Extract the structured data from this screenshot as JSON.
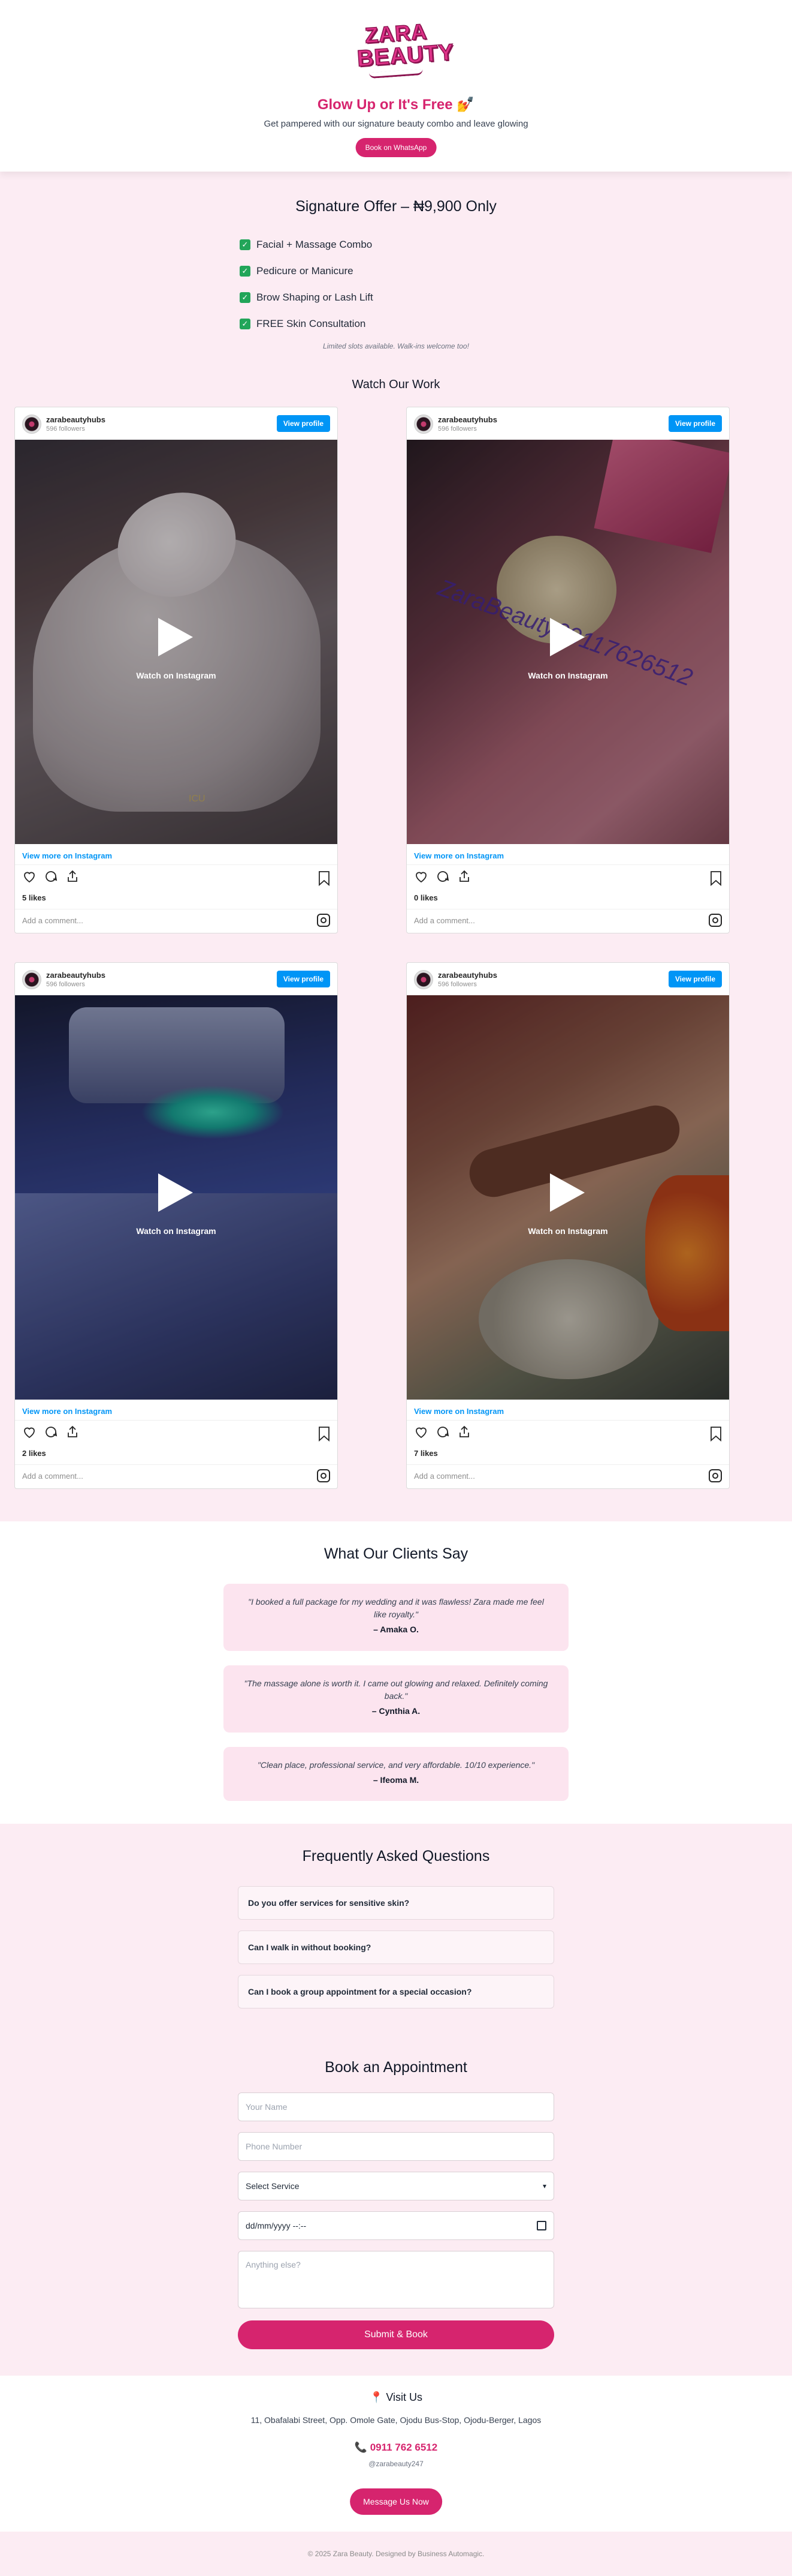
{
  "brand": {
    "logo_line1": "ZARA",
    "logo_line2": "BEAUTY",
    "accent": "#d6246e"
  },
  "hero": {
    "title": "Glow Up or It's Free 💅",
    "subtitle": "Get pampered with our signature beauty combo and leave glowing",
    "cta": "Book on WhatsApp"
  },
  "offer": {
    "title": "Signature Offer – ₦9,900 Only",
    "items": [
      "Facial + Massage Combo",
      "Pedicure or Manicure",
      "Brow Shaping or Lash Lift",
      "FREE Skin Consultation"
    ],
    "note": "Limited slots available. Walk-ins welcome too!"
  },
  "work": {
    "title": "Watch Our Work",
    "posts": [
      {
        "user": "zarabeautyhubs",
        "followers": "596 followers",
        "view": "View profile",
        "watch": "Watch on Instagram",
        "more": "View more on Instagram",
        "likes": "5 likes",
        "comment": "Add a comment...",
        "overlay": "ICU"
      },
      {
        "user": "zarabeautyhubs",
        "followers": "596 followers",
        "view": "View profile",
        "watch": "Watch on Instagram",
        "more": "View more on Instagram",
        "likes": "0 likes",
        "comment": "Add a comment...",
        "overlay": "ZaraBeauty09117626512"
      },
      {
        "user": "zarabeautyhubs",
        "followers": "596 followers",
        "view": "View profile",
        "watch": "Watch on Instagram",
        "more": "View more on Instagram",
        "likes": "2 likes",
        "comment": "Add a comment...",
        "overlay": ""
      },
      {
        "user": "zarabeautyhubs",
        "followers": "596 followers",
        "view": "View profile",
        "watch": "Watch on Instagram",
        "more": "View more on Instagram",
        "likes": "7 likes",
        "comment": "Add a comment...",
        "overlay": ""
      }
    ]
  },
  "testimonials": {
    "title": "What Our Clients Say",
    "items": [
      {
        "quote": "\"I booked a full package for my wedding and it was flawless! Zara made me feel like royalty.\"",
        "author": "– Amaka O."
      },
      {
        "quote": "\"The massage alone is worth it. I came out glowing and relaxed. Definitely coming back.\"",
        "author": "– Cynthia A."
      },
      {
        "quote": "\"Clean place, professional service, and very affordable. 10/10 experience.\"",
        "author": "– Ifeoma M."
      }
    ]
  },
  "faq": {
    "title": "Frequently Asked Questions",
    "items": [
      "Do you offer services for sensitive skin?",
      "Can I walk in without booking?",
      "Can I book a group appointment for a special occasion?"
    ]
  },
  "booking": {
    "title": "Book an Appointment",
    "name_placeholder": "Your Name",
    "phone_placeholder": "Phone Number",
    "service_selected": "Select Service",
    "datetime_placeholder": "dd/mm/yyyy --:--",
    "notes_placeholder": "Anything else?",
    "submit": "Submit & Book"
  },
  "visit": {
    "title": "Visit Us",
    "address": "11, Obafalabi Street, Opp. Omole Gate, Ojodu Bus-Stop, Ojodu-Berger, Lagos",
    "phone": "0911 762 6512",
    "handle": "@zarabeauty247",
    "cta": "Message Us Now"
  },
  "footer": {
    "text": "© 2025 Zara Beauty. Designed by Business Automagic."
  }
}
